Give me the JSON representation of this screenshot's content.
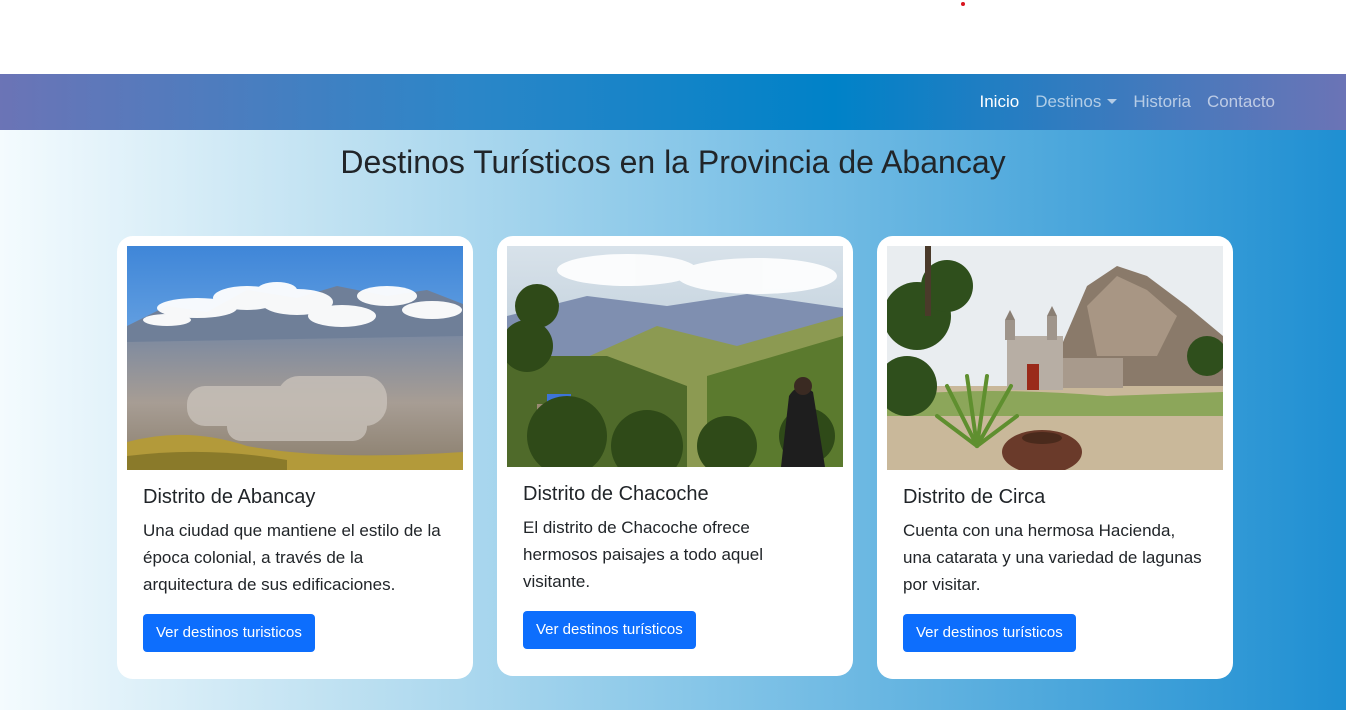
{
  "nav": {
    "items": [
      {
        "label": "Inicio",
        "active": true
      },
      {
        "label": "Destinos",
        "has_dropdown": true
      },
      {
        "label": "Historia"
      },
      {
        "label": "Contacto"
      }
    ]
  },
  "page": {
    "title": "Destinos Turísticos en la Provincia de Abancay"
  },
  "cards": [
    {
      "title": "Distrito de Abancay",
      "text": "Una ciudad que mantiene el estilo de la época colonial, a través de la arquitectura de sus edificaciones.",
      "button": "Ver destinos turisticos",
      "image_alt": "Vista panorámica de Abancay con montañas nevadas"
    },
    {
      "title": "Distrito de Chacoche",
      "text": "El distrito de Chacoche ofrece hermosos paisajes a todo aquel visitante.",
      "button": "Ver destinos turísticos",
      "image_alt": "Valle de Chacoche con persona observando"
    },
    {
      "title": "Distrito de Circa",
      "text": "Cuenta con una hermosa Hacienda, una catarata y una variedad de lagunas por visitar.",
      "button": "Ver destinos turísticos",
      "image_alt": "Iglesia colonial de Circa con montaña rocosa"
    }
  ],
  "colors": {
    "accent": "#0d6efd",
    "nav_text": "#ffffff"
  }
}
